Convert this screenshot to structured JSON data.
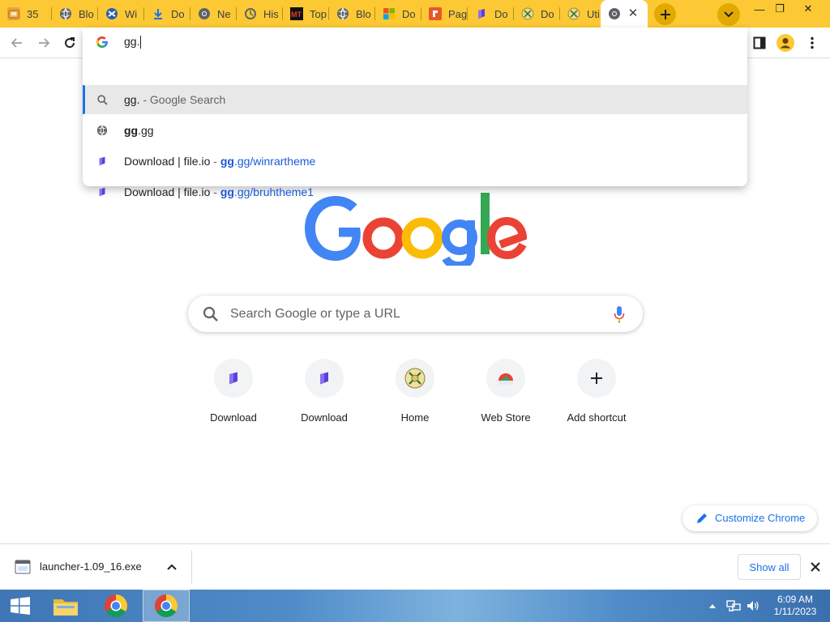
{
  "tabs": [
    {
      "label": "35",
      "icon": "puzzle-icon"
    },
    {
      "label": "Blo",
      "icon": "globe-icon"
    },
    {
      "label": "Wi",
      "icon": "windows-globe-icon"
    },
    {
      "label": "Do",
      "icon": "download-icon"
    },
    {
      "label": "Ne",
      "icon": "chrome-icon"
    },
    {
      "label": "His",
      "icon": "history-icon"
    },
    {
      "label": "Top",
      "icon": "mt-icon"
    },
    {
      "label": "Blo",
      "icon": "globe-icon"
    },
    {
      "label": "Do",
      "icon": "microsoft-icon"
    },
    {
      "label": "Pag",
      "icon": "page-icon"
    },
    {
      "label": "Do",
      "icon": "fileio-icon"
    },
    {
      "label": "Do",
      "icon": "emblem-icon"
    },
    {
      "label": "Uti",
      "icon": "emblem-icon"
    }
  ],
  "active_tab": {
    "icon": "chrome-icon",
    "close": "✕"
  },
  "window_controls": {
    "minimize": "—",
    "restore": "❐",
    "close": "✕"
  },
  "omnibox": {
    "input": "gg.",
    "suggestions": [
      {
        "type": "search",
        "icon": "search-icon",
        "main": "gg.",
        "sep": " - ",
        "desc": "Google Search"
      },
      {
        "type": "url",
        "icon": "globe-icon",
        "bold": "gg",
        "rest": ".gg"
      },
      {
        "type": "history",
        "icon": "fileio-icon",
        "title": "Download | file.io",
        "sep": " - ",
        "bold": "gg",
        "rest": ".gg/winrartheme"
      },
      {
        "type": "history",
        "icon": "fileio-icon",
        "title": "Download | file.io",
        "sep": " - ",
        "bold": "gg",
        "rest": ".gg/bruhtheme1"
      }
    ]
  },
  "search": {
    "placeholder": "Search Google or type a URL"
  },
  "shortcuts": [
    {
      "label": "Download",
      "icon": "fileio-icon"
    },
    {
      "label": "Download",
      "icon": "fileio-icon"
    },
    {
      "label": "Home",
      "icon": "emblem-icon"
    },
    {
      "label": "Web Store",
      "icon": "webstore-icon"
    },
    {
      "label": "Add shortcut",
      "icon": "plus-icon"
    }
  ],
  "customize_label": "Customize Chrome",
  "download": {
    "filename": "launcher-1.09_16.exe",
    "show_all": "Show all"
  },
  "clock": {
    "time": "6:09 AM",
    "date": "1/11/2023"
  },
  "colors": {
    "tabstrip": "#fcc934",
    "accent": "#1a73e8",
    "taskbar": "#4f8cc8"
  }
}
